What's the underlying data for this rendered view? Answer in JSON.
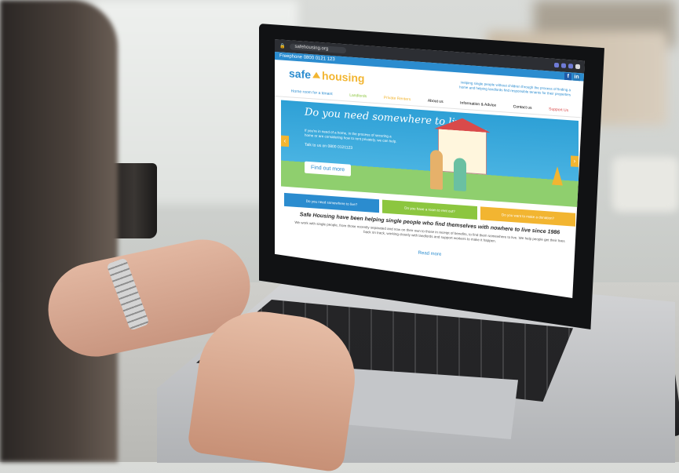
{
  "browser": {
    "url": "safehousing.org"
  },
  "topbar": {
    "phone": "Freephone 0800 0121 123",
    "facebook": "f",
    "linkedin": "in"
  },
  "header": {
    "logo_part1": "safe",
    "logo_part2": "housing",
    "tagline": "Helping single people without children through the process of finding a home and helping landlords find responsible tenants for their properties"
  },
  "nav": [
    "Home room for a tenant",
    "Landlords",
    "Private Renters",
    "About us",
    "Information & Advice",
    "Contact us",
    "Support Us"
  ],
  "hero": {
    "title": "Do you need somewhere to live",
    "text": "If you're in need of a home, in the process of securing a home or are considering how to rent privately, we can help.",
    "phone": "Talk to us on 0800 0121123",
    "button": "Find out more",
    "prev": "‹",
    "next": "›"
  },
  "cards": [
    "Do you need somewhere to live?",
    "Do you have a room to rent out?",
    "Do you want to make a donation?"
  ],
  "headline": "Safe Housing have been helping single people who find themselves with nowhere to live since 1986",
  "paragraph": "We work with single people, from those recently separated and now on their own to those in receipt of benefits, to find them somewhere to live. We help people get their lives back on track, working closely with landlords and support workers to make it happen.",
  "read_more": "Read more",
  "colors": {
    "brand_blue": "#2b8ccf",
    "brand_yellow": "#f2b531",
    "brand_green": "#8cc63f"
  }
}
